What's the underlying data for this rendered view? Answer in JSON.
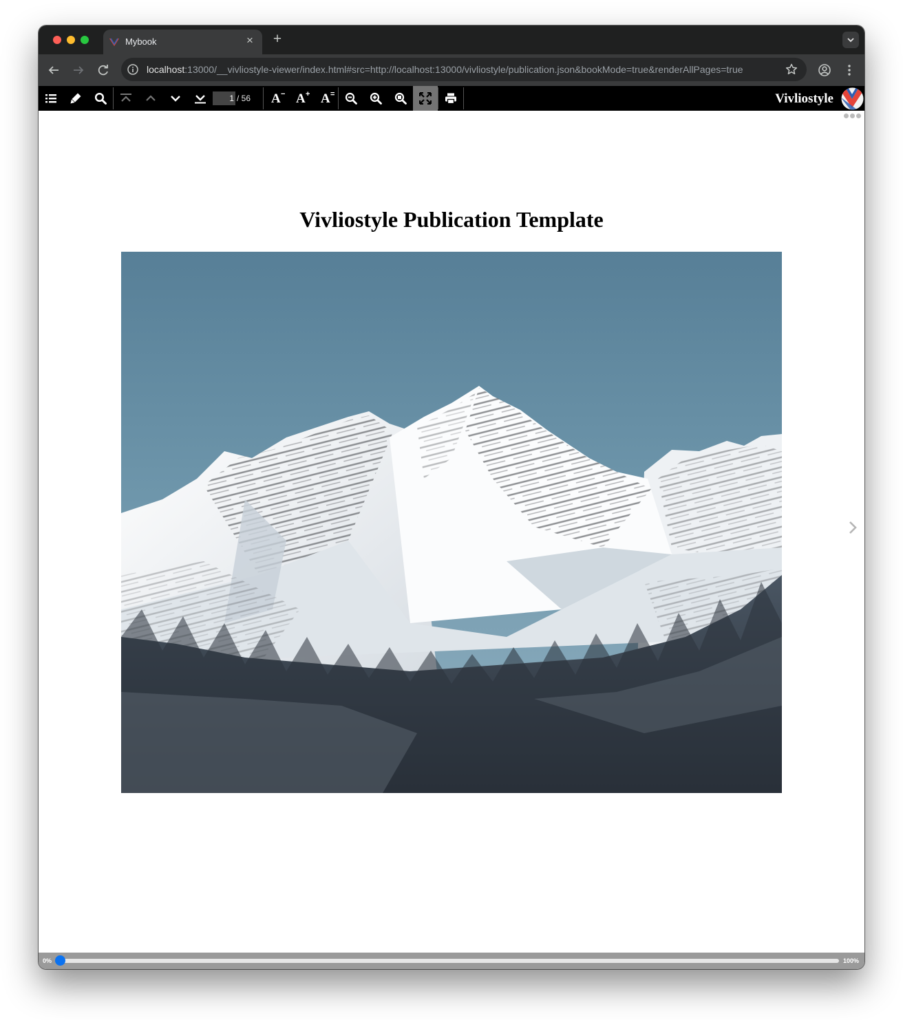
{
  "browser": {
    "tab_title": "Mybook",
    "close_glyph": "×",
    "new_tab_glyph": "+",
    "url_host": "localhost",
    "url_rest": ":13000/__vivliostyle-viewer/index.html#src=http://localhost:13000/vivliostyle/publication.json&bookMode=true&renderAllPages=true",
    "icons": [
      "vivliostyle-favicon",
      "back-arrow-icon",
      "forward-arrow-icon",
      "reload-icon",
      "site-info-icon",
      "bookmark-star-icon",
      "profile-icon",
      "kebab-menu-icon",
      "tab-list-chevron-icon"
    ]
  },
  "viewer": {
    "toolbar": {
      "current_page": "1",
      "total_pages": "/ 56",
      "font_decrease_mark": "−",
      "font_increase_mark": "+",
      "font_default_mark": "=",
      "font_glyph": "A",
      "active_button": "fit-to-screen",
      "icons": [
        "toc-list-icon",
        "marker-pen-icon",
        "search-icon",
        "first-page-icon",
        "previous-page-icon",
        "next-page-icon",
        "last-page-icon",
        "zoom-out-icon",
        "zoom-in-icon",
        "zoom-actual-size-icon",
        "fit-to-screen-icon",
        "print-icon",
        "vivliostyle-logo"
      ]
    },
    "brand_name": "Vivliostyle",
    "document": {
      "title": "Vivliostyle Publication Template",
      "image_subject": "snow-covered mountain peaks above a forested valley"
    },
    "progress": {
      "start_label": "0%",
      "end_label": "100%",
      "value": 0
    }
  },
  "colors": {
    "toolbar_bg": "#000000",
    "active_button_bg": "#737373",
    "slider_thumb": "#0b72f0",
    "brand_red": "#e5443a",
    "brand_blue": "#2f5fb3"
  }
}
